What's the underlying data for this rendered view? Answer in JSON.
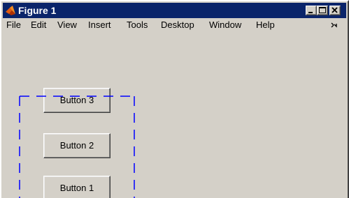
{
  "window": {
    "title": "Figure 1",
    "title_icon": "matlab-icon"
  },
  "caption_buttons": [
    "minimize-icon",
    "maximize-icon",
    "close-icon"
  ],
  "menu": {
    "items": [
      "File",
      "Edit",
      "View",
      "Insert",
      "Tools",
      "Desktop",
      "Window",
      "Help"
    ],
    "overflow_icon": "chevron-arrow-icon"
  },
  "figure": {
    "buttons": [
      {
        "label": "Button 3"
      },
      {
        "label": "Button 2"
      },
      {
        "label": "Button 1"
      }
    ],
    "selection_color": "#0000ff"
  },
  "colors": {
    "titlebar": "#0a246a",
    "face": "#d4d0c8"
  }
}
